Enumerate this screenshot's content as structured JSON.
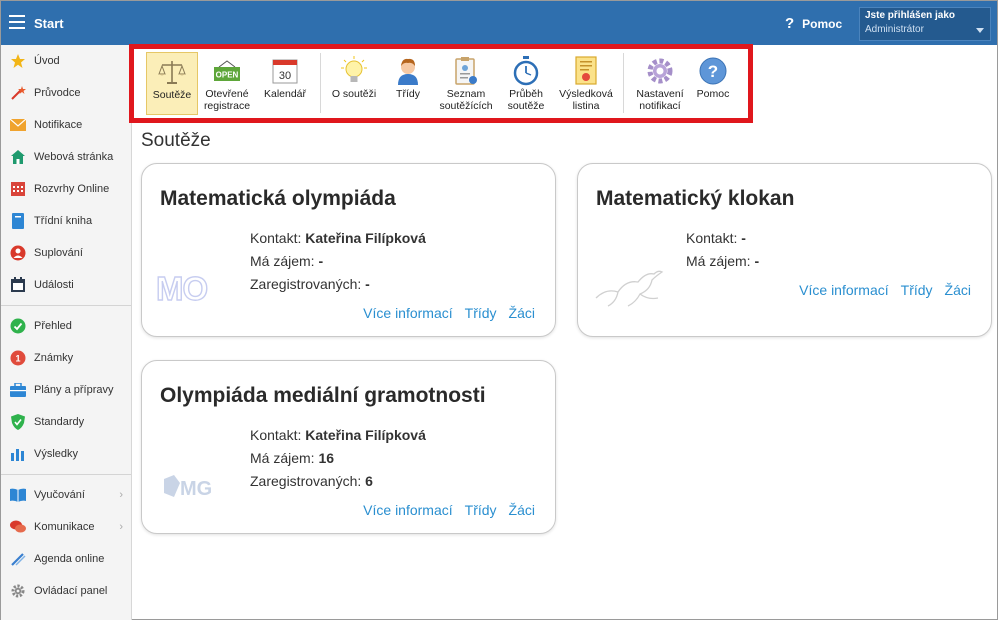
{
  "header": {
    "title": "Start",
    "help_label": "Pomoc",
    "user_line1": "Jste přihlášen jako",
    "user_line2": "Administrátor"
  },
  "sidebar": {
    "items": [
      {
        "label": "Úvod",
        "icon": "star-icon"
      },
      {
        "label": "Průvodce",
        "icon": "wand-icon"
      },
      {
        "label": "Notifikace",
        "icon": "envelope-icon"
      },
      {
        "label": "Webová stránka",
        "icon": "house-icon"
      },
      {
        "label": "Rozvrhy Online",
        "icon": "calendar-grid-icon"
      },
      {
        "label": "Třídní kniha",
        "icon": "book-icon"
      },
      {
        "label": "Suplování",
        "icon": "person-icon"
      },
      {
        "label": "Události",
        "icon": "calendar-icon"
      },
      {
        "label": "Přehled",
        "icon": "check-icon"
      },
      {
        "label": "Známky",
        "icon": "grade-icon"
      },
      {
        "label": "Plány a přípravy",
        "icon": "briefcase-icon"
      },
      {
        "label": "Standardy",
        "icon": "shield-icon"
      },
      {
        "label": "Výsledky",
        "icon": "bar-chart-icon"
      },
      {
        "label": "Vyučování",
        "icon": "open-book-icon"
      },
      {
        "label": "Komunikace",
        "icon": "chat-icon"
      },
      {
        "label": "Agenda online",
        "icon": "pen-icon"
      },
      {
        "label": "Ovládací panel",
        "icon": "gear-icon"
      }
    ]
  },
  "toolbar": {
    "items": [
      {
        "label": "Soutěže",
        "icon": "scales-icon"
      },
      {
        "label": "Otevřené registrace",
        "icon": "open-sign-icon",
        "badge": "OPEN"
      },
      {
        "label": "Kalendář",
        "icon": "calendar-icon",
        "badge": "30"
      },
      {
        "label": "O soutěži",
        "icon": "lightbulb-icon"
      },
      {
        "label": "Třídy",
        "icon": "student-icon"
      },
      {
        "label": "Seznam soutěžících",
        "icon": "clipboard-icon"
      },
      {
        "label": "Průběh soutěže",
        "icon": "stopwatch-icon"
      },
      {
        "label": "Výsledková listina",
        "icon": "certificate-icon"
      },
      {
        "label": "Nastavení notifikací",
        "icon": "gear-icon"
      },
      {
        "label": "Pomoc",
        "icon": "help-icon"
      }
    ]
  },
  "main": {
    "title": "Soutěže",
    "cards": [
      {
        "title": "Matematická olympiáda",
        "contact_label": "Kontakt:",
        "contact_value": "Kateřina Filípková",
        "interest_label": "Má zájem:",
        "interest_value": "-",
        "registered_label": "Zaregistrovaných:",
        "registered_value": "-",
        "logo_text": "MO",
        "links": [
          "Více informací",
          "Třídy",
          "Žáci"
        ]
      },
      {
        "title": "Matematický klokan",
        "contact_label": "Kontakt:",
        "contact_value": "-",
        "interest_label": "Má zájem:",
        "interest_value": "-",
        "links": [
          "Více informací",
          "Třídy",
          "Žáci"
        ]
      },
      {
        "title": "Olympiáda mediální gramotnosti",
        "contact_label": "Kontakt:",
        "contact_value": "Kateřina Filípková",
        "interest_label": "Má zájem:",
        "interest_value": "16",
        "registered_label": "Zaregistrovaných:",
        "registered_value": "6",
        "logo_text": "MG",
        "links": [
          "Více informací",
          "Třídy",
          "Žáci"
        ]
      }
    ]
  },
  "colors": {
    "header_bg": "#2f6fae",
    "link": "#2a8fd0",
    "highlight_border": "#e0171d",
    "active_bg": "#fbeeb8"
  }
}
